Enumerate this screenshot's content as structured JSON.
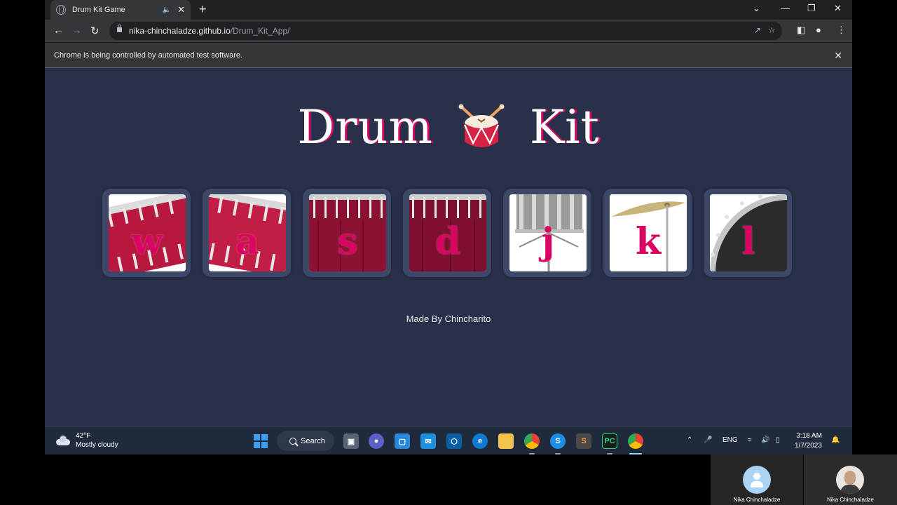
{
  "browser": {
    "tab_title": "Drum Kit Game",
    "url_host": "nika-chinchaladze.github.io",
    "url_path": "/Drum_Kit_App/",
    "infobar_message": "Chrome is being controlled by automated test software."
  },
  "page": {
    "title_left": "Drum",
    "title_right": "Kit",
    "keys": [
      {
        "letter": "w",
        "drum": "red-drum"
      },
      {
        "letter": "a",
        "drum": "red-drum"
      },
      {
        "letter": "s",
        "drum": "dark-red-drum"
      },
      {
        "letter": "d",
        "drum": "dark-red-drum"
      },
      {
        "letter": "j",
        "drum": "snare"
      },
      {
        "letter": "k",
        "drum": "cymbal"
      },
      {
        "letter": "l",
        "drum": "bass-drum"
      }
    ],
    "footer": "Made By Chincharito"
  },
  "taskbar": {
    "weather_temp": "42°F",
    "weather_desc": "Mostly cloudy",
    "search_label": "Search",
    "language": "ENG",
    "time": "3:18 AM",
    "date": "1/7/2023"
  },
  "call": {
    "participants": [
      "Nika Chinchaladze",
      "Nika Chinchaladze"
    ]
  },
  "colors": {
    "page_bg": "#283149",
    "key_frame": "#3d4766",
    "accent": "#DA0463"
  }
}
